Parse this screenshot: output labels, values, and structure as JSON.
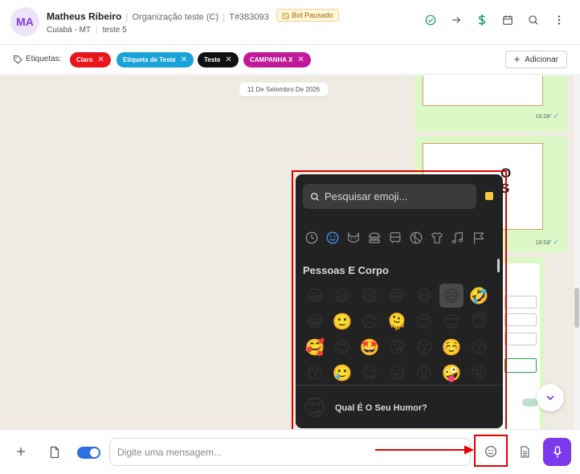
{
  "header": {
    "avatar_initials": "MA",
    "contact_name": "Matheus Ribeiro",
    "organization": "Organização teste (C)",
    "ticket": "T#383093",
    "bot_badge": "Bot Pausado",
    "location": "Cuiabá - MT",
    "queue": "teste 5",
    "icons": [
      "check-circle-icon",
      "arrow-right-icon",
      "dollar-icon",
      "calendar-icon",
      "search-icon",
      "more-vertical-icon"
    ]
  },
  "tags_bar": {
    "label": "Etiquetas:",
    "tags": [
      {
        "text": "Claro",
        "color": "#e8161b"
      },
      {
        "text": "Etiqueta de Teste",
        "color": "#1aa3d8"
      },
      {
        "text": "Teste",
        "color": "#111111"
      },
      {
        "text": "CAMPANHA X",
        "color": "#c2189a"
      }
    ],
    "add_button": "Adicionar"
  },
  "chat": {
    "date_pill": "11 De Setembro De 2026",
    "messages": [
      {
        "time": "18:28"
      },
      {
        "time": "18:52",
        "partial_text": [
          "O",
          "S"
        ]
      }
    ]
  },
  "emoji_picker": {
    "search_placeholder": "Pesquisar emoji...",
    "category_icons": [
      "clock-icon",
      "smiley-icon",
      "cat-icon",
      "burger-icon",
      "bus-icon",
      "ball-icon",
      "shirt-icon",
      "music-note-icon",
      "flag-icon"
    ],
    "section_title": "Pessoas E Corpo",
    "emojis": [
      "😀",
      "😃",
      "😄",
      "😁",
      "😆",
      "😅",
      "🤣",
      "😂",
      "🙂",
      "🙃",
      "🫠",
      "😉",
      "😊",
      "😇",
      "🥰",
      "😍",
      "🤩",
      "😘",
      "😗",
      "☺️",
      "😚",
      "😙",
      "🥲",
      "😋",
      "😛",
      "😜",
      "🤪",
      "😝"
    ],
    "selected_index": 5,
    "footer_emoji": "😊",
    "footer_text": "Qual É O Seu Humor?"
  },
  "composer": {
    "placeholder": "Digite uma mensagem...",
    "toggle_on": true
  },
  "colors": {
    "brand": "#7c3aed",
    "highlight": "#e00000",
    "chat_bg": "#efeae2",
    "bubble_out": "#dcf8c6"
  }
}
